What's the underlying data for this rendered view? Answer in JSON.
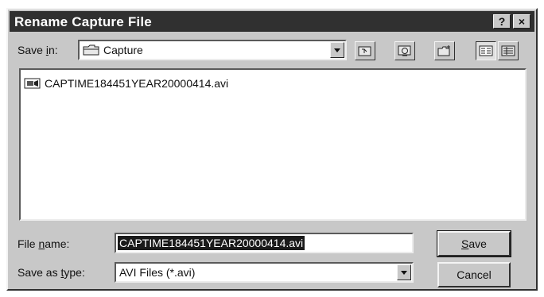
{
  "window": {
    "title": "Rename Capture File",
    "help_label": "?",
    "close_label": "×"
  },
  "save_in": {
    "label_pre": "Save ",
    "label_u": "i",
    "label_post": "n:",
    "value": "Capture"
  },
  "toolbar": {
    "icons": [
      "up-one-level-icon",
      "desktop-icon",
      "new-folder-icon",
      "list-view-icon",
      "details-view-icon"
    ]
  },
  "files": [
    {
      "name": "CAPTIME184451YEAR20000414.avi",
      "icon": "video-file-icon"
    }
  ],
  "file_name": {
    "label_pre": "File ",
    "label_u": "n",
    "label_post": "ame:",
    "value": "CAPTIME184451YEAR20000414.avi"
  },
  "save_as_type": {
    "label_pre": "Save as ",
    "label_u": "t",
    "label_post": "ype:",
    "value": "AVI Files (*.avi)"
  },
  "buttons": {
    "save_u": "S",
    "save_rest": "ave",
    "cancel": "Cancel"
  },
  "colors": {
    "face": "#c8c8c8",
    "title_bg": "#303030",
    "selection": "#1a1a1a"
  }
}
